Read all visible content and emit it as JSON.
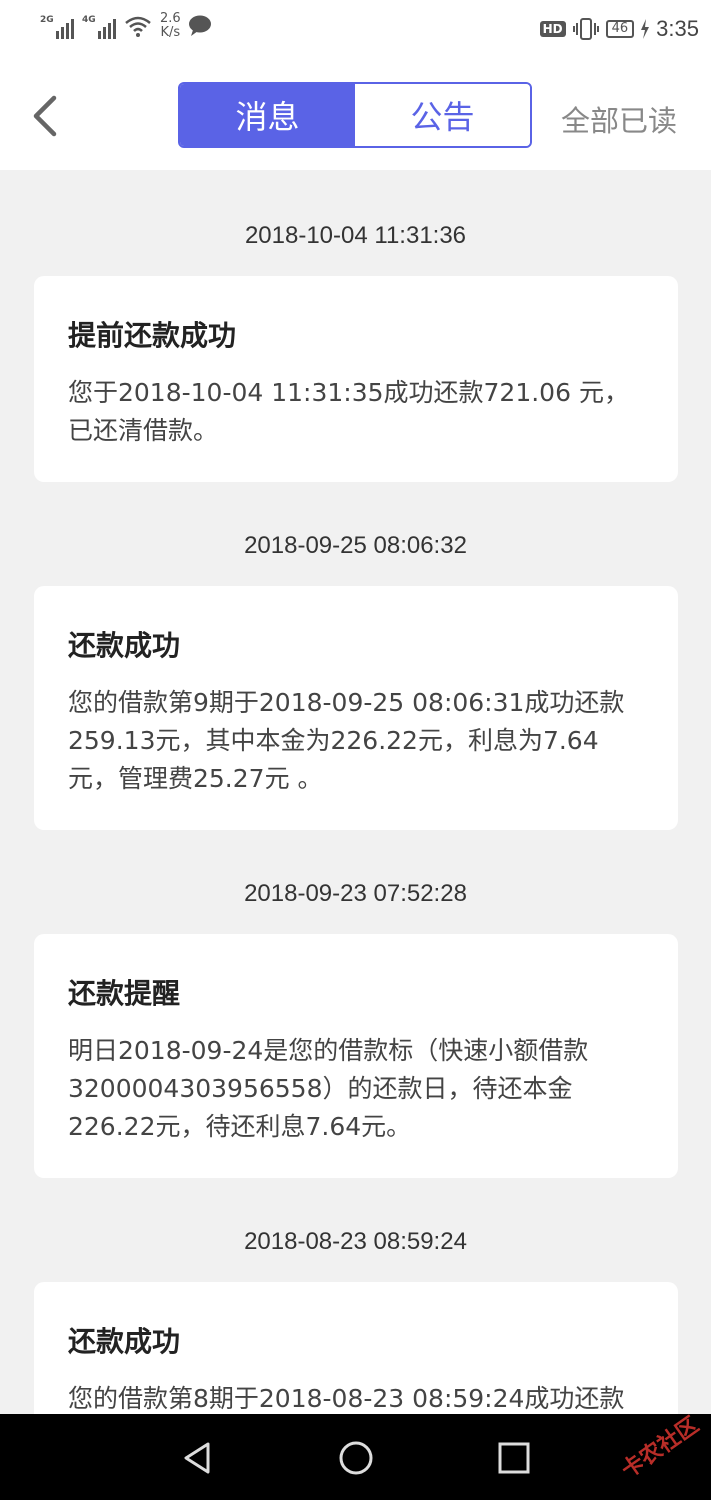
{
  "status_bar": {
    "signal1_tag": "2G",
    "signal2_tag": "4G",
    "net_speed_value": "2.6",
    "net_speed_unit": "K/s",
    "hd_badge": "HD",
    "battery_level": "46",
    "time": "3:35"
  },
  "header": {
    "tabs": [
      {
        "label": "消息",
        "active": true
      },
      {
        "label": "公告",
        "active": false
      }
    ],
    "mark_all_read": "全部已读"
  },
  "messages": [
    {
      "timestamp": "2018-10-04 11:31:36",
      "title": "提前还款成功",
      "body": "您于2018-10-04 11:31:35成功还款721.06 元，已还清借款。"
    },
    {
      "timestamp": "2018-09-25 08:06:32",
      "title": "还款成功",
      "body": "您的借款第9期于2018-09-25 08:06:31成功还款259.13元，其中本金为226.22元，利息为7.64元，管理费25.27元 。"
    },
    {
      "timestamp": "2018-09-23 07:52:28",
      "title": "还款提醒",
      "body": "明日2018-09-24是您的借款标（快速小额借款3200004303956558）的还款日，待还本金226.22元，待还利息7.64元。"
    },
    {
      "timestamp": "2018-08-23 08:59:24",
      "title": "还款成功",
      "body": "您的借款第8期于2018-08-23 08:59:24成功还款"
    }
  ],
  "colors": {
    "accent": "#5a63e6",
    "background": "#f1f1f1"
  },
  "watermark": "卡农社区"
}
